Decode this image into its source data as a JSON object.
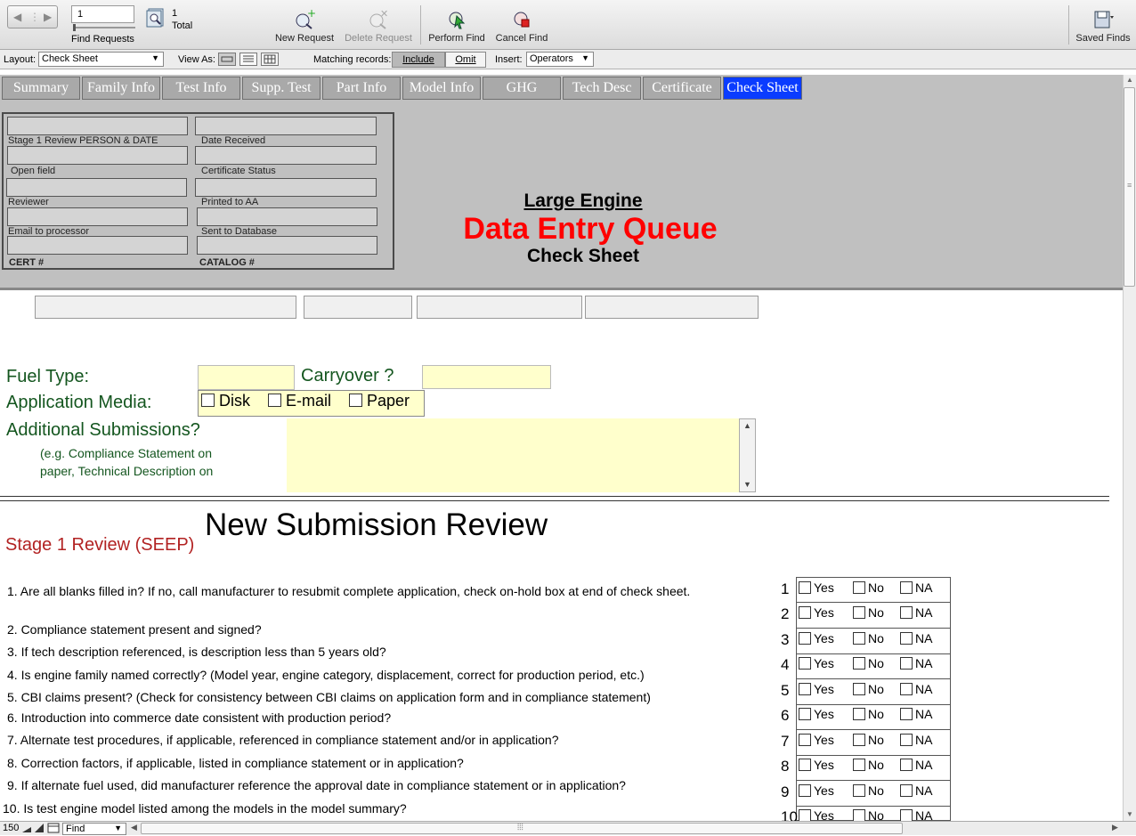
{
  "toolbar": {
    "record_value": "1",
    "found_count": "1",
    "found_label": "Total",
    "find_requests_label": "Find Requests",
    "new_request": "New Request",
    "delete_request": "Delete Request",
    "perform_find": "Perform Find",
    "cancel_find": "Cancel Find",
    "saved_finds": "Saved Finds"
  },
  "layoutbar": {
    "layout_label": "Layout:",
    "layout_value": "Check Sheet",
    "view_as_label": "View As:",
    "matching_label": "Matching records:",
    "include_label": "Include",
    "omit_label": "Omit",
    "insert_label": "Insert:",
    "insert_value": "Operators"
  },
  "tabs": [
    "Summary",
    "Family Info",
    "Test Info",
    "Supp. Test",
    "Part Info",
    "Model Info",
    "GHG",
    "Tech Desc",
    "Certificate",
    "Check Sheet"
  ],
  "header_fields": {
    "stage1": "Stage 1 Review PERSON & DATE",
    "date_received": "Date  Received",
    "open_field": "Open field",
    "certificate_status": "Certificate Status",
    "reviewer": "Reviewer",
    "printed_to_aa": "Printed to AA",
    "email_to_processor": "Email to processor",
    "sent_to_database": "Sent to Database",
    "cert_no": "CERT #",
    "catalog_no": "CATALOG #"
  },
  "titles": {
    "line1": "Large Engine",
    "line2": "Data Entry Queue",
    "line3": "Check Sheet"
  },
  "form": {
    "fuel_type_label": "Fuel Type:",
    "carryover_label": "Carryover ?",
    "application_media_label": "Application Media:",
    "media_options": [
      "Disk",
      "E-mail",
      "Paper"
    ],
    "additional_label": "Additional Submissions?",
    "additional_hint_1": "(e.g. Compliance Statement on",
    "additional_hint_2": "paper, Technical Description on"
  },
  "review": {
    "title": "New Submission Review",
    "stage": "Stage 1 Review (SEEP)",
    "yn_labels": [
      "Yes",
      "No",
      "NA"
    ],
    "numbers": [
      "1",
      "2",
      "3",
      "4",
      "5",
      "6",
      "7",
      "8",
      "9",
      "10"
    ],
    "questions": [
      "1.  Are all blanks filled in?  If no, call manufacturer to resubmit complete application, check on-hold box at end of check sheet.",
      "2.  Compliance statement present and signed?",
      "3.  If tech description referenced, is description less than 5 years old?",
      "4.  Is engine family named correctly? (Model year, engine category, displacement, correct for production period, etc.)",
      "5.  CBI claims present?  (Check for consistency between CBI claims on application form and in compliance statement)",
      "6.  Introduction into commerce date consistent with production period?",
      "7.  Alternate test procedures, if applicable, referenced in compliance statement and/or in application?",
      "8.  Correction factors, if applicable, listed in compliance statement or in application?",
      "9.  If alternate fuel used, did manufacturer reference the approval date in compliance statement or in application?",
      "10.  Is test engine model listed among the models in the model summary?"
    ]
  },
  "statusbar": {
    "zoom": "150",
    "mode": "Find"
  }
}
